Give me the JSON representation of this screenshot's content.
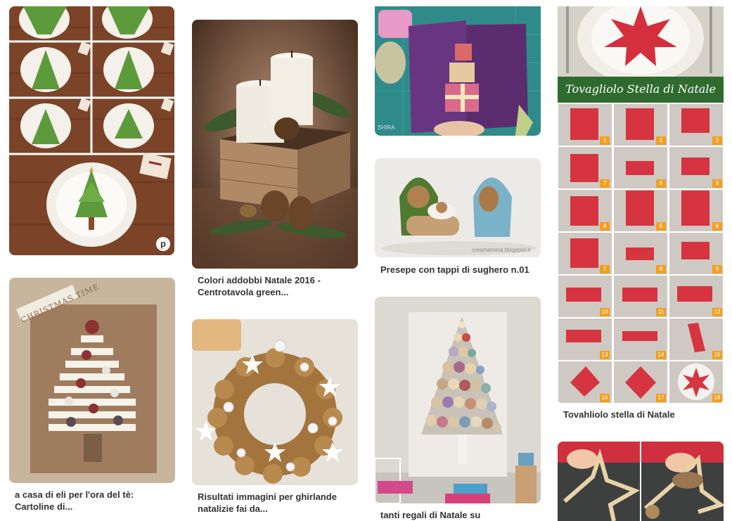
{
  "pins": [
    {
      "id": "napkin-tree",
      "caption": "",
      "badge": "p"
    },
    {
      "id": "centrepiece",
      "caption": "Colori addobbi Natale 2016 - Centrotavola green..."
    },
    {
      "id": "gift-card",
      "caption": "",
      "watermark": "SHIRA"
    },
    {
      "id": "star-napkin",
      "overlay_title": "Tovagliolo Stella di Natale",
      "caption": "Tovahliolo stella di Natale",
      "step_numbers": [
        "1",
        "2",
        "3",
        "7",
        "8",
        "9",
        "4",
        "5",
        "6",
        "7",
        "8",
        "9",
        "10",
        "11",
        "12",
        "13",
        "14",
        "15",
        "16",
        "17",
        "18"
      ]
    },
    {
      "id": "nativity",
      "caption": "Presepe con tappi di sughero n.01",
      "watermark": "creamamma.blogspot.it"
    },
    {
      "id": "button-tree-card",
      "caption": "a casa di eli per l'ora del tè: Cartoline di...",
      "card_text": "CHRISTMAS TIME"
    },
    {
      "id": "walnut-wreath",
      "caption": "Risultati immagini per ghirlande natalizie fai da..."
    },
    {
      "id": "tube-tree",
      "caption": "tanti regali di Natale su"
    },
    {
      "id": "stick-star",
      "caption": ""
    }
  ]
}
